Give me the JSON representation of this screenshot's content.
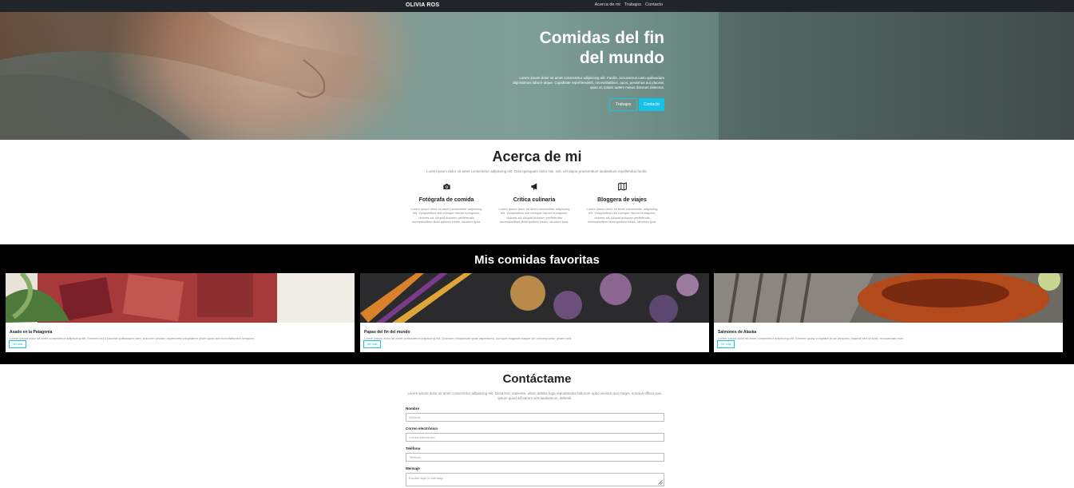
{
  "nav": {
    "brand": "OLIVIA ROS",
    "links": [
      "Acerca de mi",
      "Trabajos",
      "Contacto"
    ]
  },
  "hero": {
    "title_line1": "Comidas del fin",
    "title_line2": "del mundo",
    "text": "Lorem ipsum dolor sit amet consectetur adipiscing elit. Facilis, accusamus iusto quibusdam dignissimos labore atque. Cupiditate reprehenderit, necessitatibus, quos, possimus aut placeat, quas ut, ipsam autem minus dolorum delectus.",
    "btn_works": "Trabajos",
    "btn_contact": "Contacto"
  },
  "about": {
    "title": "Acerca de mi",
    "intro": "Lorem ipsum dolor sit amet consectetur adipiscing elit. Odio quisquam dolor nisi, sint, vel atque praesentium laudantium repellendus facilis.",
    "features": [
      {
        "icon": "camera-icon",
        "title": "Fotógrafa de comida",
        "text": "Lorem ipsum dolor sit amet consectetur adipiscing elit. Voluptatibus nisi cumque harum numquam, dolores ad. Aliquid dolorum perferendis necessitatibus dicta quidem totam, laborum ipsa."
      },
      {
        "icon": "megaphone-icon",
        "title": "Crítica culinaria",
        "text": "Lorem ipsum dolor sit amet consectetur adipiscing elit. Voluptatibus nisi cumque harum numquam, dolores ad. Aliquid dolorum perferendis necessitatibus dicta quidem totam, laborum ipsa."
      },
      {
        "icon": "map-icon",
        "title": "Bloggera de viajes",
        "text": "Lorem ipsum dolor sit amet consectetur adipiscing elit. Voluptatibus nisi cumque harum numquam, dolores ad. Aliquid dolorum perferendis necessitatibus dicta quidem totam, laborum ipsa."
      }
    ]
  },
  "favorites": {
    "title": "Mis comidas favoritas",
    "cards": [
      {
        "title": "Asado en la Patagonia",
        "text": "Lorem ipsum dolor sit amet consectetur adipiscing elit. Eveniet nisi a placeat quibusdam nam, dolorum veniam asperiores voluptatem ullam quos aut exercitationem tempore.",
        "more": "Ver más"
      },
      {
        "title": "Papas del fin del mundo",
        "text": "Lorem ipsum dolor sit amet consectetur adipiscing elit. Dolorum voluptatum quas asperiores, cumque magnam eaque vel consequuntur ipsam sed.",
        "more": "Ver más"
      },
      {
        "title": "Salmones de Alaska",
        "text": "Lorem ipsum dolor sit amet consectetur adipiscing elit. Eveniet quasi voluptate at ab tempora, impedit sint ut sunt, recusandae eum.",
        "more": "Ver más"
      }
    ]
  },
  "contact": {
    "title": "Contáctame",
    "intro": "Lorem ipsum dolor sit amet consectetur adipiscing elit. Dicta eos, sapiente, ullam debitis fuga repudiandae laborum optio veniam quo magni, suscipit officia quis, ipsum quod ad earum sint laudantium, deleniti.",
    "name_label": "Nombre",
    "name_placeholder": "Nombre",
    "email_label": "Correo electrónico",
    "email_placeholder": "Correo electrónico",
    "phone_label": "Teléfono",
    "phone_placeholder": "Teléfono",
    "message_label": "Mensaje",
    "message_placeholder": "Escribe aquí tu mensaje"
  },
  "colors": {
    "accent": "#17c1e8",
    "nav_bg": "#212529",
    "fav_bg": "#000000"
  }
}
